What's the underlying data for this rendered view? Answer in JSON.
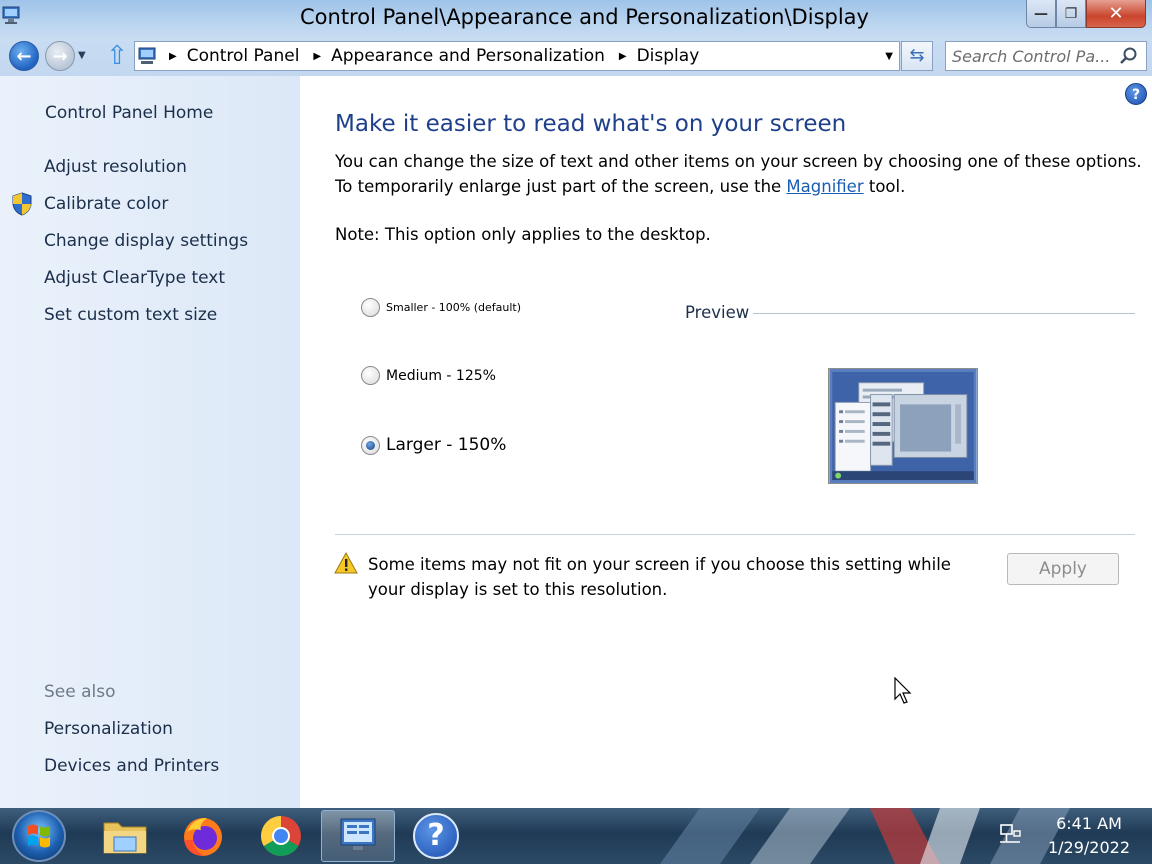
{
  "window": {
    "title": "Control Panel\\Appearance and Personalization\\Display",
    "minimize_glyph": "—",
    "maximize_glyph": "❐",
    "close_glyph": "✕"
  },
  "navbar": {
    "back_glyph": "←",
    "forward_glyph": "→",
    "breadcrumbs": [
      "Control Panel",
      "Appearance and Personalization",
      "Display"
    ],
    "search_placeholder": "Search Control Pa..."
  },
  "sidebar": {
    "home_label": "Control Panel Home",
    "tasks": [
      {
        "label": "Adjust resolution"
      },
      {
        "label": "Calibrate color",
        "icon": "uac-shield-icon"
      },
      {
        "label": "Change display settings"
      },
      {
        "label": "Adjust ClearType text"
      },
      {
        "label": "Set custom text size"
      }
    ],
    "see_also_heading": "See also",
    "see_also": [
      {
        "label": "Personalization"
      },
      {
        "label": "Devices and Printers"
      }
    ]
  },
  "main": {
    "help_glyph": "?",
    "title": "Make it easier to read what's on your screen",
    "desc_before_link": "You can change the size of text and other items on your screen by choosing one of these options. To temporarily enlarge just part of the screen, use the ",
    "magnifier_link": "Magnifier",
    "desc_after_link": " tool.",
    "note": "Note: This option only applies to the desktop.",
    "options": [
      {
        "label": "Smaller - 100% (default)",
        "checked": false
      },
      {
        "label": "Medium - 125%",
        "checked": false
      },
      {
        "label": "Larger - 150%",
        "checked": true
      }
    ],
    "preview_label": "Preview",
    "warning": "Some items may not fit on your screen if you choose this setting while your display is set to this resolution.",
    "apply_label": "Apply",
    "apply_enabled": false
  },
  "taskbar": {
    "items": [
      {
        "name": "file-explorer",
        "icon": "folder-icon"
      },
      {
        "name": "firefox",
        "icon": "firefox-icon"
      },
      {
        "name": "chrome",
        "icon": "chrome-icon"
      },
      {
        "name": "control-panel",
        "icon": "control-panel-icon",
        "active": true
      },
      {
        "name": "help-and-support",
        "icon": "help-icon"
      }
    ],
    "help_glyph": "?",
    "time": "6:41 AM",
    "date": "1/29/2022"
  },
  "colors": {
    "title_blue": "#1e3f8a",
    "link_blue": "#1a5db5",
    "sidebar_bg": "#dce8f7"
  }
}
